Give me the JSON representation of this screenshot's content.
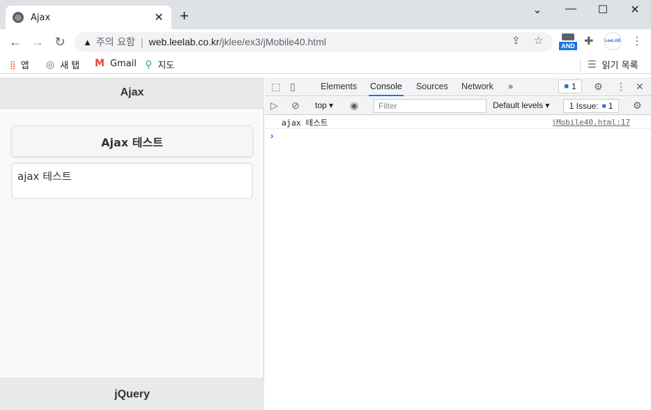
{
  "browser": {
    "tab_title": "Ajax",
    "tab_close": "✕",
    "new_tab": "+",
    "window_controls": {
      "minimize": "—",
      "maximize": "☐",
      "close": "✕",
      "menu": "⌄"
    },
    "security_label": "주의 요함",
    "url_host": "web.leelab.co.kr",
    "url_path": "/jklee/ex3/jMobile40.html",
    "ext_and_label": "AND",
    "ext_leelab_label": "LeeLAB"
  },
  "bookmarks": {
    "apps": "앱",
    "newtab": "새 탭",
    "gmail": "Gmail",
    "maps": "지도",
    "reading_list": "읽기 목록"
  },
  "page": {
    "header_title": "Ajax",
    "button_label": "Ajax 테스트",
    "textarea_value": "ajax 테스트",
    "footer_title": "jQuery"
  },
  "devtools": {
    "tabs": [
      "Elements",
      "Console",
      "Sources",
      "Network"
    ],
    "active_tab": "Console",
    "more_tabs": "»",
    "message_count": "1",
    "context": "top",
    "filter_placeholder": "Filter",
    "levels": "Default levels",
    "issues_label": "1 Issue:",
    "issues_count": "1",
    "log_message": "ajax 테스트",
    "log_source": "jMobile40.html:17",
    "prompt": "›"
  },
  "colors": {
    "accent": "#1a73e8",
    "jqm_bar": "#e9e9e9"
  }
}
